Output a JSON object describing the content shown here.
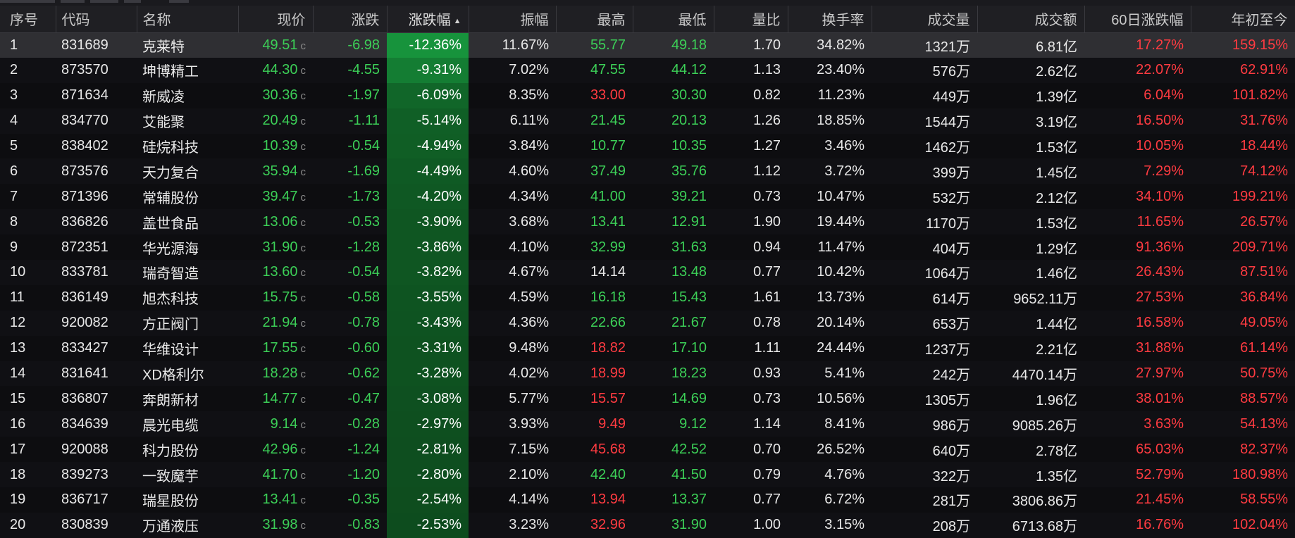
{
  "colors": {
    "up": "#ff3b41",
    "down": "#3ccf57",
    "neutral": "#e8e8e8",
    "header_bg": "#1f1f23",
    "selected_row_bg": "#2f2f33",
    "heat_strong": "#17933c",
    "heat_weak": "#0b3a16"
  },
  "sort": {
    "column": "涨跌幅",
    "direction": "ascending",
    "icon": "sort-caret-up-icon"
  },
  "columns": [
    {
      "key": "idx",
      "label": "序号",
      "align": "left"
    },
    {
      "key": "code",
      "label": "代码",
      "align": "left"
    },
    {
      "key": "name",
      "label": "名称",
      "align": "left"
    },
    {
      "key": "price",
      "label": "现价",
      "align": "right"
    },
    {
      "key": "chg",
      "label": "涨跌",
      "align": "right"
    },
    {
      "key": "pct",
      "label": "涨跌幅",
      "align": "right"
    },
    {
      "key": "amp",
      "label": "振幅",
      "align": "right"
    },
    {
      "key": "high",
      "label": "最高",
      "align": "right"
    },
    {
      "key": "low",
      "label": "最低",
      "align": "right"
    },
    {
      "key": "vr",
      "label": "量比",
      "align": "right"
    },
    {
      "key": "turn",
      "label": "换手率",
      "align": "right"
    },
    {
      "key": "vol",
      "label": "成交量",
      "align": "right"
    },
    {
      "key": "amt",
      "label": "成交额",
      "align": "right"
    },
    {
      "key": "d60",
      "label": "60日涨跌幅",
      "align": "right"
    },
    {
      "key": "ytd",
      "label": "年初至今",
      "align": "right"
    }
  ],
  "price_suffix": "c",
  "rows": [
    {
      "idx": "1",
      "code": "831689",
      "name": "克莱特",
      "price": "49.51",
      "chg": "-6.98",
      "pct": "-12.36%",
      "amp": "11.67%",
      "high": "55.77",
      "high_dir": "g",
      "low": "49.18",
      "vr": "1.70",
      "turn": "34.82%",
      "vol": "1321万",
      "amt": "6.81亿",
      "d60": "17.27%",
      "ytd": "159.15%",
      "heat": 1.0
    },
    {
      "idx": "2",
      "code": "873570",
      "name": "坤博精工",
      "price": "44.30",
      "chg": "-4.55",
      "pct": "-9.31%",
      "amp": "7.02%",
      "high": "47.55",
      "high_dir": "g",
      "low": "44.12",
      "vr": "1.13",
      "turn": "23.40%",
      "vol": "576万",
      "amt": "2.62亿",
      "d60": "22.07%",
      "ytd": "62.91%",
      "heat": 0.75
    },
    {
      "idx": "3",
      "code": "871634",
      "name": "新威凌",
      "price": "30.36",
      "chg": "-1.97",
      "pct": "-6.09%",
      "amp": "8.35%",
      "high": "33.00",
      "high_dir": "r",
      "low": "30.30",
      "vr": "0.82",
      "turn": "11.23%",
      "vol": "449万",
      "amt": "1.39亿",
      "d60": "6.04%",
      "ytd": "101.82%",
      "heat": 0.49
    },
    {
      "idx": "4",
      "code": "834770",
      "name": "艾能聚",
      "price": "20.49",
      "chg": "-1.11",
      "pct": "-5.14%",
      "amp": "6.11%",
      "high": "21.45",
      "high_dir": "g",
      "low": "20.13",
      "vr": "1.26",
      "turn": "18.85%",
      "vol": "1544万",
      "amt": "3.19亿",
      "d60": "16.50%",
      "ytd": "31.76%",
      "heat": 0.42
    },
    {
      "idx": "5",
      "code": "838402",
      "name": "硅烷科技",
      "price": "10.39",
      "chg": "-0.54",
      "pct": "-4.94%",
      "amp": "3.84%",
      "high": "10.77",
      "high_dir": "g",
      "low": "10.35",
      "vr": "1.27",
      "turn": "3.46%",
      "vol": "1462万",
      "amt": "1.53亿",
      "d60": "10.05%",
      "ytd": "18.44%",
      "heat": 0.4
    },
    {
      "idx": "6",
      "code": "873576",
      "name": "天力复合",
      "price": "35.94",
      "chg": "-1.69",
      "pct": "-4.49%",
      "amp": "4.60%",
      "high": "37.49",
      "high_dir": "g",
      "low": "35.76",
      "vr": "1.12",
      "turn": "3.72%",
      "vol": "399万",
      "amt": "1.45亿",
      "d60": "7.29%",
      "ytd": "74.12%",
      "heat": 0.36
    },
    {
      "idx": "7",
      "code": "871396",
      "name": "常辅股份",
      "price": "39.47",
      "chg": "-1.73",
      "pct": "-4.20%",
      "amp": "4.34%",
      "high": "41.00",
      "high_dir": "g",
      "low": "39.21",
      "vr": "0.73",
      "turn": "10.47%",
      "vol": "532万",
      "amt": "2.12亿",
      "d60": "34.10%",
      "ytd": "199.21%",
      "heat": 0.34
    },
    {
      "idx": "8",
      "code": "836826",
      "name": "盖世食品",
      "price": "13.06",
      "chg": "-0.53",
      "pct": "-3.90%",
      "amp": "3.68%",
      "high": "13.41",
      "high_dir": "g",
      "low": "12.91",
      "vr": "1.90",
      "turn": "19.44%",
      "vol": "1170万",
      "amt": "1.53亿",
      "d60": "11.65%",
      "ytd": "26.57%",
      "heat": 0.32
    },
    {
      "idx": "9",
      "code": "872351",
      "name": "华光源海",
      "price": "31.90",
      "chg": "-1.28",
      "pct": "-3.86%",
      "amp": "4.10%",
      "high": "32.99",
      "high_dir": "g",
      "low": "31.63",
      "vr": "0.94",
      "turn": "11.47%",
      "vol": "404万",
      "amt": "1.29亿",
      "d60": "91.36%",
      "ytd": "209.71%",
      "heat": 0.31
    },
    {
      "idx": "10",
      "code": "833781",
      "name": "瑞奇智造",
      "price": "13.60",
      "chg": "-0.54",
      "pct": "-3.82%",
      "amp": "4.67%",
      "high": "14.14",
      "high_dir": "w",
      "low": "13.48",
      "vr": "0.77",
      "turn": "10.42%",
      "vol": "1064万",
      "amt": "1.46亿",
      "d60": "26.43%",
      "ytd": "87.51%",
      "heat": 0.31
    },
    {
      "idx": "11",
      "code": "836149",
      "name": "旭杰科技",
      "price": "15.75",
      "chg": "-0.58",
      "pct": "-3.55%",
      "amp": "4.59%",
      "high": "16.18",
      "high_dir": "g",
      "low": "15.43",
      "vr": "1.61",
      "turn": "13.73%",
      "vol": "614万",
      "amt": "9652.11万",
      "d60": "27.53%",
      "ytd": "36.84%",
      "heat": 0.29
    },
    {
      "idx": "12",
      "code": "920082",
      "name": "方正阀门",
      "price": "21.94",
      "chg": "-0.78",
      "pct": "-3.43%",
      "amp": "4.36%",
      "high": "22.66",
      "high_dir": "g",
      "low": "21.67",
      "vr": "0.78",
      "turn": "20.14%",
      "vol": "653万",
      "amt": "1.44亿",
      "d60": "16.58%",
      "ytd": "49.05%",
      "heat": 0.28
    },
    {
      "idx": "13",
      "code": "833427",
      "name": "华维设计",
      "price": "17.55",
      "chg": "-0.60",
      "pct": "-3.31%",
      "amp": "9.48%",
      "high": "18.82",
      "high_dir": "r",
      "low": "17.10",
      "vr": "1.11",
      "turn": "24.44%",
      "vol": "1237万",
      "amt": "2.21亿",
      "d60": "31.88%",
      "ytd": "61.14%",
      "heat": 0.27
    },
    {
      "idx": "14",
      "code": "831641",
      "name": "XD格利尔",
      "price": "18.28",
      "chg": "-0.62",
      "pct": "-3.28%",
      "amp": "4.02%",
      "high": "18.99",
      "high_dir": "r",
      "low": "18.23",
      "vr": "0.93",
      "turn": "5.41%",
      "vol": "242万",
      "amt": "4470.14万",
      "d60": "27.97%",
      "ytd": "50.75%",
      "heat": 0.27
    },
    {
      "idx": "15",
      "code": "836807",
      "name": "奔朗新材",
      "price": "14.77",
      "chg": "-0.47",
      "pct": "-3.08%",
      "amp": "5.77%",
      "high": "15.57",
      "high_dir": "r",
      "low": "14.69",
      "vr": "0.73",
      "turn": "10.56%",
      "vol": "1305万",
      "amt": "1.96亿",
      "d60": "38.01%",
      "ytd": "88.57%",
      "heat": 0.25
    },
    {
      "idx": "16",
      "code": "834639",
      "name": "晨光电缆",
      "price": "9.14",
      "chg": "-0.28",
      "pct": "-2.97%",
      "amp": "3.93%",
      "high": "9.49",
      "high_dir": "r",
      "low": "9.12",
      "vr": "1.14",
      "turn": "8.41%",
      "vol": "986万",
      "amt": "9085.26万",
      "d60": "3.63%",
      "ytd": "54.13%",
      "heat": 0.24
    },
    {
      "idx": "17",
      "code": "920088",
      "name": "科力股份",
      "price": "42.96",
      "chg": "-1.24",
      "pct": "-2.81%",
      "amp": "7.15%",
      "high": "45.68",
      "high_dir": "r",
      "low": "42.52",
      "vr": "0.70",
      "turn": "26.52%",
      "vol": "640万",
      "amt": "2.78亿",
      "d60": "65.03%",
      "ytd": "82.37%",
      "heat": 0.23
    },
    {
      "idx": "18",
      "code": "839273",
      "name": "一致魔芋",
      "price": "41.70",
      "chg": "-1.20",
      "pct": "-2.80%",
      "amp": "2.10%",
      "high": "42.40",
      "high_dir": "g",
      "low": "41.50",
      "vr": "0.79",
      "turn": "4.76%",
      "vol": "322万",
      "amt": "1.35亿",
      "d60": "52.79%",
      "ytd": "180.98%",
      "heat": 0.23
    },
    {
      "idx": "19",
      "code": "836717",
      "name": "瑞星股份",
      "price": "13.41",
      "chg": "-0.35",
      "pct": "-2.54%",
      "amp": "4.14%",
      "high": "13.94",
      "high_dir": "r",
      "low": "13.37",
      "vr": "0.77",
      "turn": "6.72%",
      "vol": "281万",
      "amt": "3806.86万",
      "d60": "21.45%",
      "ytd": "58.55%",
      "heat": 0.21
    },
    {
      "idx": "20",
      "code": "830839",
      "name": "万通液压",
      "price": "31.98",
      "chg": "-0.83",
      "pct": "-2.53%",
      "amp": "3.23%",
      "high": "32.96",
      "high_dir": "r",
      "low": "31.90",
      "vr": "1.00",
      "turn": "3.15%",
      "vol": "208万",
      "amt": "6713.68万",
      "d60": "16.76%",
      "ytd": "102.04%",
      "heat": 0.2
    }
  ]
}
